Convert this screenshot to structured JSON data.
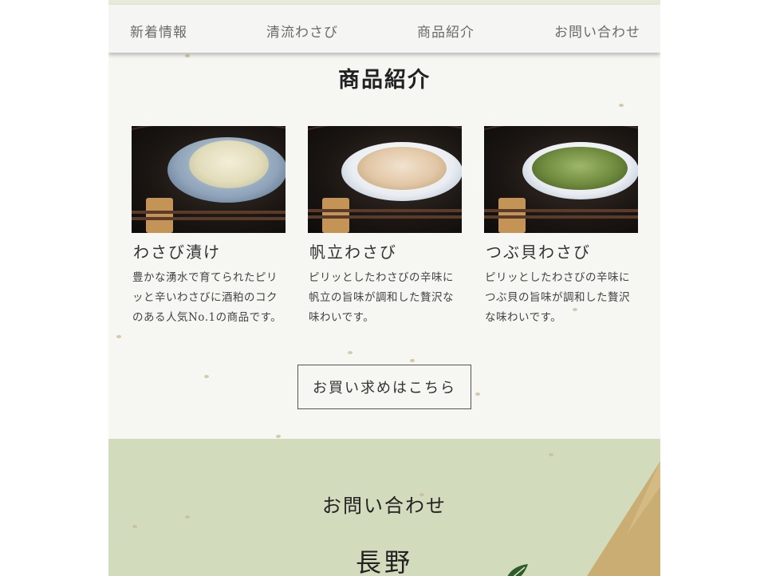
{
  "nav": {
    "items": [
      {
        "label": "新着情報"
      },
      {
        "label": "清流わさび"
      },
      {
        "label": "商品紹介"
      },
      {
        "label": "お問い合わせ"
      }
    ]
  },
  "products_section": {
    "title": "商品紹介",
    "products": [
      {
        "name": "わさび漬け",
        "description": "豊かな湧水で育てられたピリッと辛いわさびに酒粕のコクのある人気No.1の商品です。"
      },
      {
        "name": "帆立わさび",
        "description": "ピリッとしたわさびの辛味に帆立の旨味が調和した贅沢な味わいです。"
      },
      {
        "name": "つぶ貝わさび",
        "description": "ピリッとしたわさびの辛味につぶ貝の旨味が調和した贅沢な味わいです。"
      }
    ],
    "buy_button_label": "お買い求めはこちら"
  },
  "contact_section": {
    "title": "お問い合わせ",
    "subtitle": "長野"
  },
  "colors": {
    "paper_bg": "#f6f6f3",
    "nav_text": "#6b6b6b",
    "contact_bg": "#d2dcbd",
    "gold_accent": "#c9ad72"
  }
}
